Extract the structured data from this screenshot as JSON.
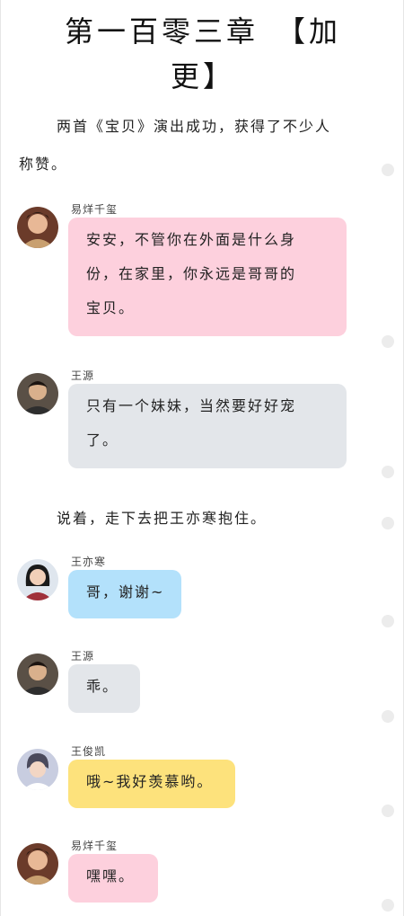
{
  "chapter": {
    "title_line1": "第一百零三章　【加",
    "title_line2": "更】"
  },
  "narration": [
    "两首《宝贝》演出成功，获得了不少人",
    "称赞。",
    "说着，走下去把王亦寒抱住。"
  ],
  "messages": [
    {
      "sender": "易烊千玺",
      "lines": [
        "安安，不管你在外面是什么身",
        "份，在家里，你永远是哥哥的",
        "宝贝。"
      ],
      "bubble_color": "#fdd0dd"
    },
    {
      "sender": "王源",
      "lines": [
        "只有一个妹妹，当然要好好宠",
        "了。"
      ],
      "bubble_color": "#e3e6ea"
    },
    {
      "sender": "王亦寒",
      "lines": [
        "哥，谢谢~"
      ],
      "bubble_color": "#b3e1fb"
    },
    {
      "sender": "王源",
      "lines": [
        "乖。"
      ],
      "bubble_color": "#e3e6ea"
    },
    {
      "sender": "王俊凯",
      "lines": [
        "哦~我好羡慕哟。"
      ],
      "bubble_color": "#fde27c"
    },
    {
      "sender": "易烊千玺",
      "lines": [
        "嘿嘿。"
      ],
      "bubble_color": "#fdd0dd"
    }
  ]
}
